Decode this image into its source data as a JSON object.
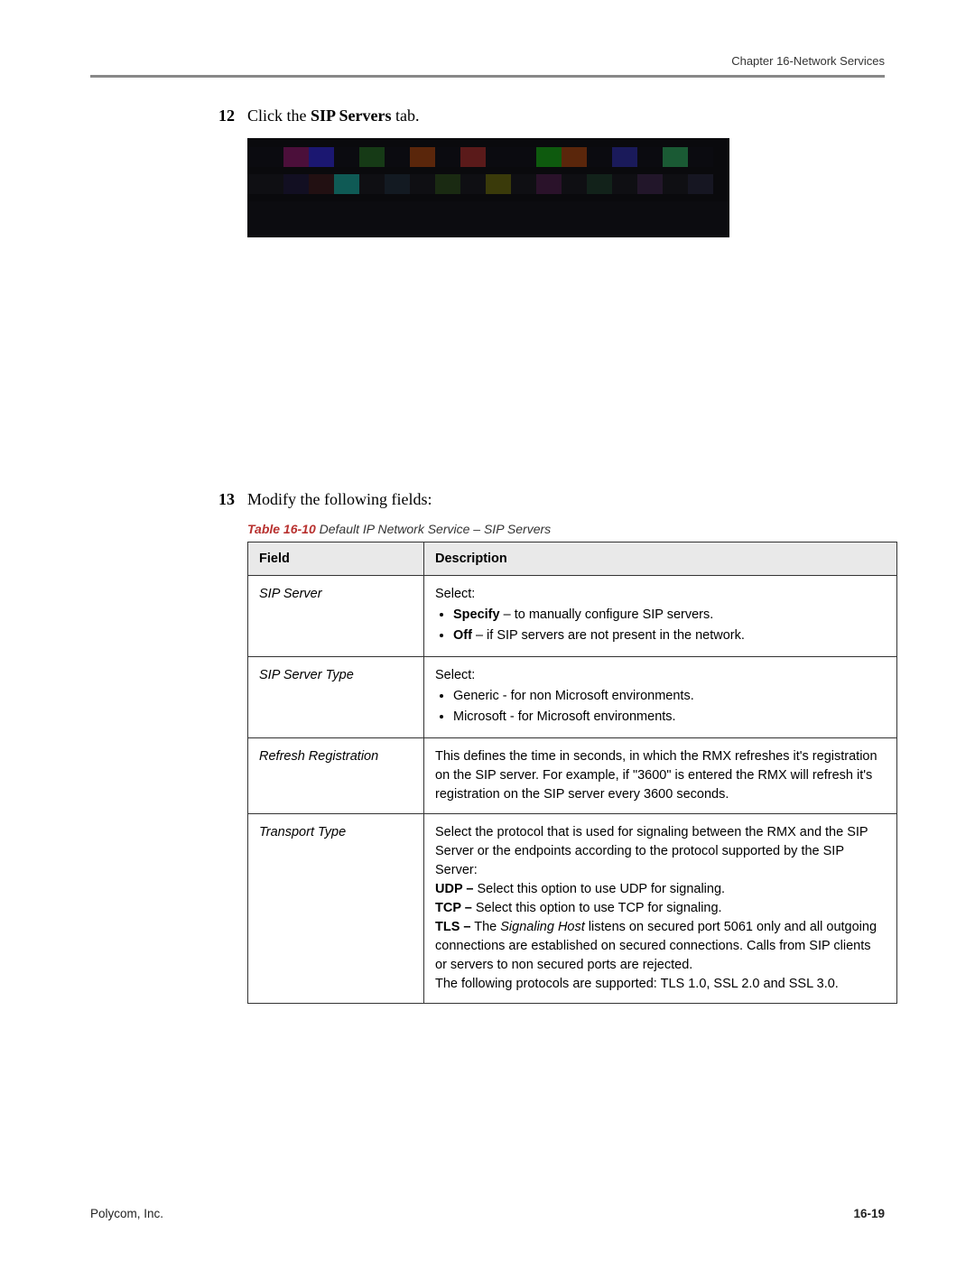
{
  "header": {
    "chapter": "Chapter 16-Network Services"
  },
  "steps": {
    "s12": {
      "num": "12",
      "prefix": "Click the ",
      "bold": "SIP Servers",
      "suffix": " tab."
    },
    "s13": {
      "num": "13",
      "text": "Modify the following fields:"
    }
  },
  "table": {
    "caption_bold": "Table 16-10",
    "caption_rest": " Default IP Network Service – SIP Servers",
    "head_field": "Field",
    "head_desc": "Description",
    "rows": {
      "r0_field": "SIP Server",
      "r0_select": "Select:",
      "r0_b1_strong": "Specify",
      "r0_b1_rest": " – to manually configure SIP servers.",
      "r0_b2_strong": "Off",
      "r0_b2_rest": " – if SIP servers are not present in the network.",
      "r1_field": "SIP Server Type",
      "r1_select": "Select:",
      "r1_b1": "Generic - for non Microsoft environments.",
      "r1_b2": "Microsoft - for Microsoft environments.",
      "r2_field": "Refresh Registration",
      "r2_desc": "This defines the time in seconds, in which the RMX refreshes it's registration on the SIP server. For example, if \"3600\" is entered the RMX will refresh it's registration on the SIP server every 3600 seconds.",
      "r3_field": "Transport Type",
      "r3_p0": "Select the protocol that is used for signaling between the RMX and the SIP Server or the endpoints according to the protocol supported by the SIP Server:",
      "r3_udp_b": "UDP –",
      "r3_udp_r": " Select this option to use UDP for signaling.",
      "r3_tcp_b": "TCP –",
      "r3_tcp_r": " Select this option to use TCP for signaling.",
      "r3_tls_b": "TLS –",
      "r3_tls_pre": " The ",
      "r3_tls_i": "Signaling Host",
      "r3_tls_r": " listens on secured port 5061 only and all outgoing connections are established on secured connections. Calls from SIP clients or servers to non secured ports are rejected.",
      "r3_p1": "The following protocols are supported: TLS 1.0, SSL 2.0 and SSL 3.0."
    }
  },
  "footer": {
    "company": "Polycom, Inc.",
    "page": "16-19"
  }
}
